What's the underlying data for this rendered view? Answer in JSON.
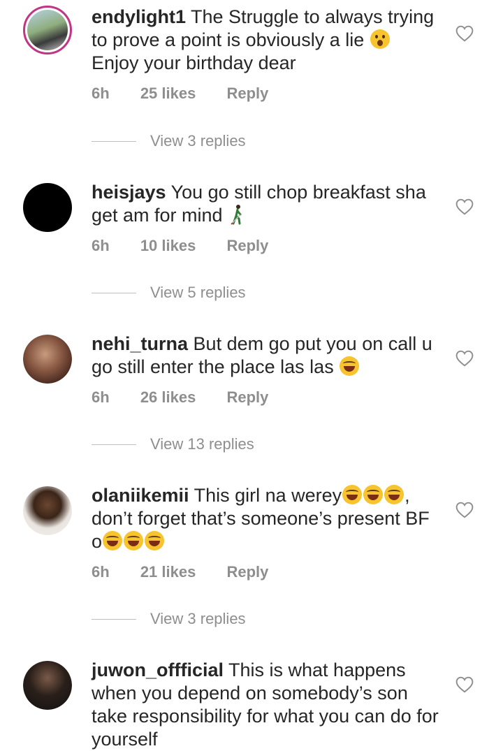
{
  "comments": [
    {
      "username": "endylight1",
      "text": "The Struggle to always trying to prove a point is obviously a lie",
      "text_end": "Enjoy your birthday dear",
      "time": "6h",
      "likes": "25 likes",
      "reply": "Reply",
      "view_replies": "View 3 replies"
    },
    {
      "username": "heisjays",
      "text": "You go still chop breakfast sha get am for mind",
      "time": "6h",
      "likes": "10 likes",
      "reply": "Reply",
      "view_replies": "View 5 replies"
    },
    {
      "username": "nehi_turna",
      "text": "But dem go  put you on call u go still enter the place las las",
      "time": "6h",
      "likes": "26 likes",
      "reply": "Reply",
      "view_replies": "View 13 replies"
    },
    {
      "username": "olaniikemii",
      "text": "This girl na werey",
      "text_mid": ", don’t forget that’s someone’s present BF o",
      "time": "6h",
      "likes": "21 likes",
      "reply": "Reply",
      "view_replies": "View 3 replies"
    },
    {
      "username": "juwon_offficial",
      "text": "This is what happens when you depend on somebody’s son take responsibility for what you can do for yourself"
    }
  ],
  "colors": {
    "meta": "#8e8e8e",
    "text": "#262626",
    "story_ring": "#c13584"
  },
  "icons": {
    "like": "heart-outline-icon",
    "emoji_laugh": "face-with-tears-of-joy",
    "emoji_shock": "face-with-open-mouth",
    "emoji_walk": "person-with-white-cane"
  }
}
